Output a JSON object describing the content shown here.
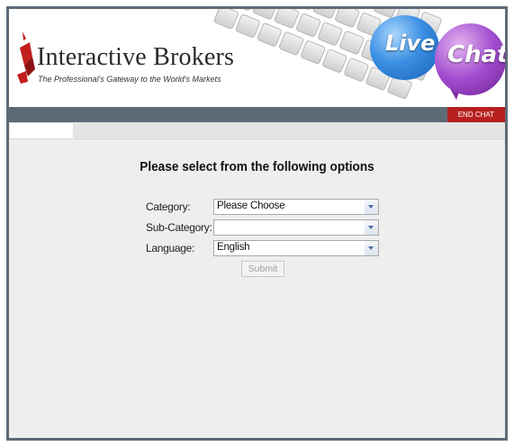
{
  "brand": {
    "name": "Interactive Brokers",
    "tagline": "The Professional's Gateway to the World's Markets"
  },
  "banner": {
    "live_label": "Live",
    "chat_label": "Chat"
  },
  "nav": {
    "end_chat_label": "END CHAT"
  },
  "form": {
    "heading": "Please select from the following options",
    "category": {
      "label": "Category:",
      "value": "Please Choose"
    },
    "subcategory": {
      "label": "Sub-Category:",
      "value": ""
    },
    "language": {
      "label": "Language:",
      "value": "English"
    },
    "submit_label": "Submit"
  },
  "colors": {
    "nav_bar": "#5d6b76",
    "end_chat_bg": "#b71f1f",
    "live_bubble": "#3a8fe3",
    "chat_bubble": "#a24ccf",
    "panel_bg": "#eeeeee"
  }
}
